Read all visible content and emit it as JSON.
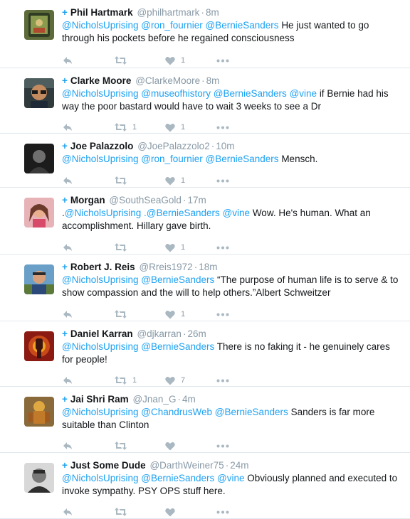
{
  "colors": {
    "link": "#1da1f2",
    "muted": "#8899a6",
    "divider": "#e1e8ed"
  },
  "tweets": [
    {
      "name": "Phil Hartmark",
      "handle": "@philhartmark",
      "time": "8m",
      "mentions": [
        "@NicholsUprising",
        "@ron_fournier",
        "@BernieSanders"
      ],
      "text": "He just wanted to go through his pockets before he regained consciousness",
      "retweets": "",
      "likes": "1",
      "avatar": "phone-photo"
    },
    {
      "name": "Clarke Moore",
      "handle": "@ClarkeMoore",
      "time": "8m",
      "mentions": [
        "@NicholsUprising",
        "@museofhistory",
        "@BernieSanders",
        "@vine"
      ],
      "text": "if Bernie had his way the poor bastard would have to wait 3 weeks to see a Dr",
      "retweets": "1",
      "likes": "1",
      "avatar": "man-with-glasses"
    },
    {
      "name": "Joe Palazzolo",
      "handle": "@JoePalazzolo2",
      "time": "10m",
      "mentions": [
        "@NicholsUprising",
        "@ron_fournier",
        "@BernieSanders"
      ],
      "text": "Mensch.",
      "retweets": "",
      "likes": "1",
      "avatar": "dark-portrait"
    },
    {
      "name": "Morgan",
      "handle": "@SouthSeaGold",
      "time": "17m",
      "lead": ".",
      "mentions": [
        "@NicholsUprising",
        ".@BernieSanders",
        "@vine"
      ],
      "text": " Wow. He's human. What an accomplishment. Hillary gave birth.",
      "retweets": "",
      "likes": "1",
      "avatar": "woman-pink"
    },
    {
      "name": "Robert J. Reis",
      "handle": "@Rreis1972",
      "time": "18m",
      "mentions": [
        "@NicholsUprising",
        "@BernieSanders"
      ],
      "text": "“The purpose of human life is to serve & to show compassion and the will to help others.”Albert Schweitzer",
      "retweets": "",
      "likes": "1",
      "avatar": "man-outdoors"
    },
    {
      "name": "Daniel Karran",
      "handle": "@djkarran",
      "time": "26m",
      "mentions": [
        "@NicholsUprising",
        "@BernieSanders"
      ],
      "text": "There is no faking it - he genuinely cares for people!",
      "retweets": "1",
      "likes": "7",
      "avatar": "raised-fist"
    },
    {
      "name": "Jai Shri Ram",
      "handle": "@Jnan_G",
      "time": "4m",
      "mentions": [
        "@NicholsUprising",
        "@ChandrusWeb",
        "@BernieSanders"
      ],
      "text": "Sanders is far more suitable than Clinton",
      "retweets": "",
      "likes": "",
      "avatar": "deity-art"
    },
    {
      "name": "Just Some Dude",
      "handle": "@DarthWeiner75",
      "time": "24m",
      "mentions": [
        "@NicholsUprising",
        "@BernieSanders",
        "@vine"
      ],
      "text": "Obviously planned and executed to invoke sympathy. PSY OPS stuff here.",
      "retweets": "",
      "likes": "",
      "avatar": "bw-portrait"
    }
  ]
}
